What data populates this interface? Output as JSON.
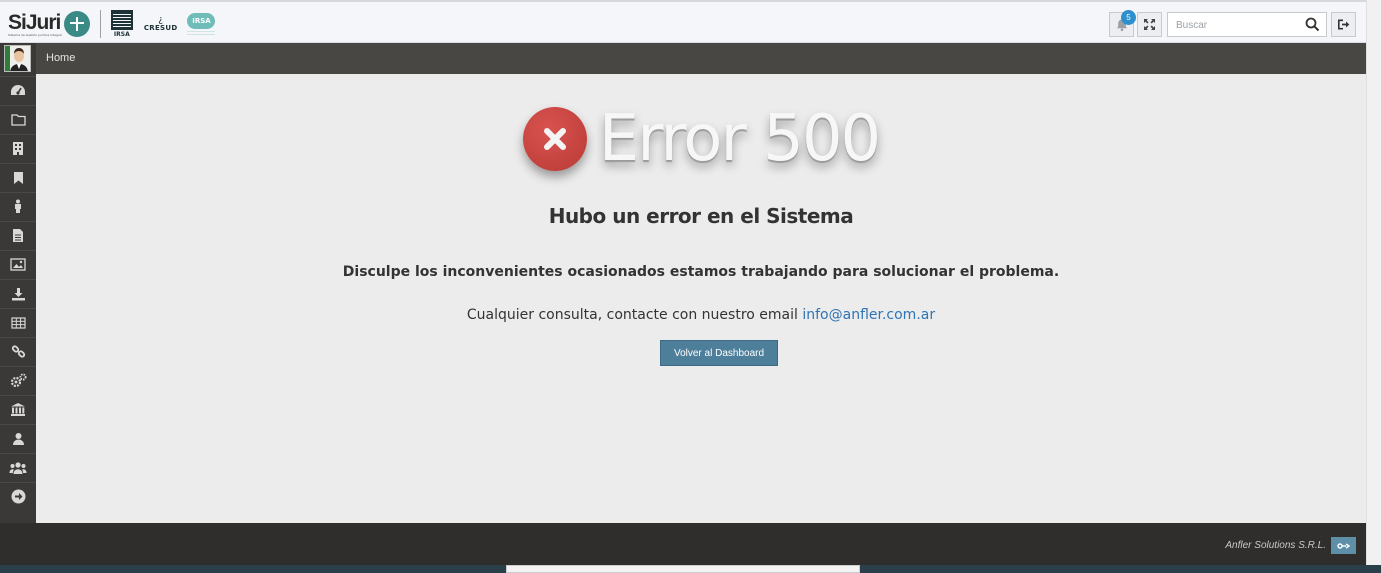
{
  "header": {
    "brand": "SiJuri",
    "brand_sub": "Sistema de Gestión Jurídica Integral",
    "partner_logos": [
      "IRSA",
      "CRESUD",
      "IRSA"
    ],
    "notification_count": "5",
    "search_placeholder": "Buscar"
  },
  "breadcrumb": {
    "current": "Home"
  },
  "sidebar": {
    "items": [
      {
        "icon": "dashboard-icon"
      },
      {
        "icon": "folder-icon"
      },
      {
        "icon": "building-icon"
      },
      {
        "icon": "bookmark-icon"
      },
      {
        "icon": "person-icon"
      },
      {
        "icon": "document-icon"
      },
      {
        "icon": "image-icon"
      },
      {
        "icon": "download-icon"
      },
      {
        "icon": "table-icon"
      },
      {
        "icon": "link-icon"
      },
      {
        "icon": "gears-icon"
      },
      {
        "icon": "bank-icon"
      },
      {
        "icon": "user-icon"
      },
      {
        "icon": "users-icon"
      },
      {
        "icon": "arrow-right-circle-icon"
      }
    ]
  },
  "main": {
    "error_title": "Error 500",
    "error_subtitle": "Hubo un error en el Sistema",
    "error_description": "Disculpe los inconvenientes ocasionados estamos trabajando para solucionar el problema.",
    "contact_text": "Cualquier consulta, contacte con nuestro email",
    "contact_email": "info@anfler.com.ar",
    "back_button": "Volver al Dashboard"
  },
  "footer": {
    "company": "Anfler Solutions S.R.L."
  },
  "colors": {
    "accent": "#4e7f9a",
    "error": "#c9413d",
    "sidebar": "#3a3937",
    "breadcrumb": "#484744",
    "link": "#2f74b5"
  }
}
